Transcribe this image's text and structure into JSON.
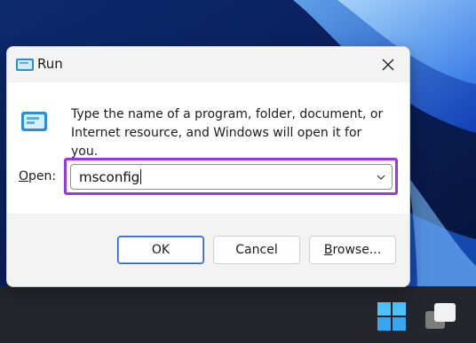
{
  "dialog": {
    "title": "Run",
    "description": "Type the name of a program, folder, document, or Internet resource, and Windows will open it for you.",
    "open_label_mnemonic": "O",
    "open_label_rest": "pen:",
    "input_value": "msconfig",
    "buttons": {
      "ok": "OK",
      "cancel": "Cancel",
      "browse_mnemonic": "B",
      "browse_rest": "rowse..."
    },
    "highlight_color": "#9a35e8",
    "icons": {
      "title": "run-icon",
      "main": "run-icon",
      "close": "close-icon",
      "dropdown": "chevron-down-icon"
    }
  },
  "taskbar": {
    "icons": [
      "windows-start-icon",
      "task-view-icon"
    ]
  }
}
